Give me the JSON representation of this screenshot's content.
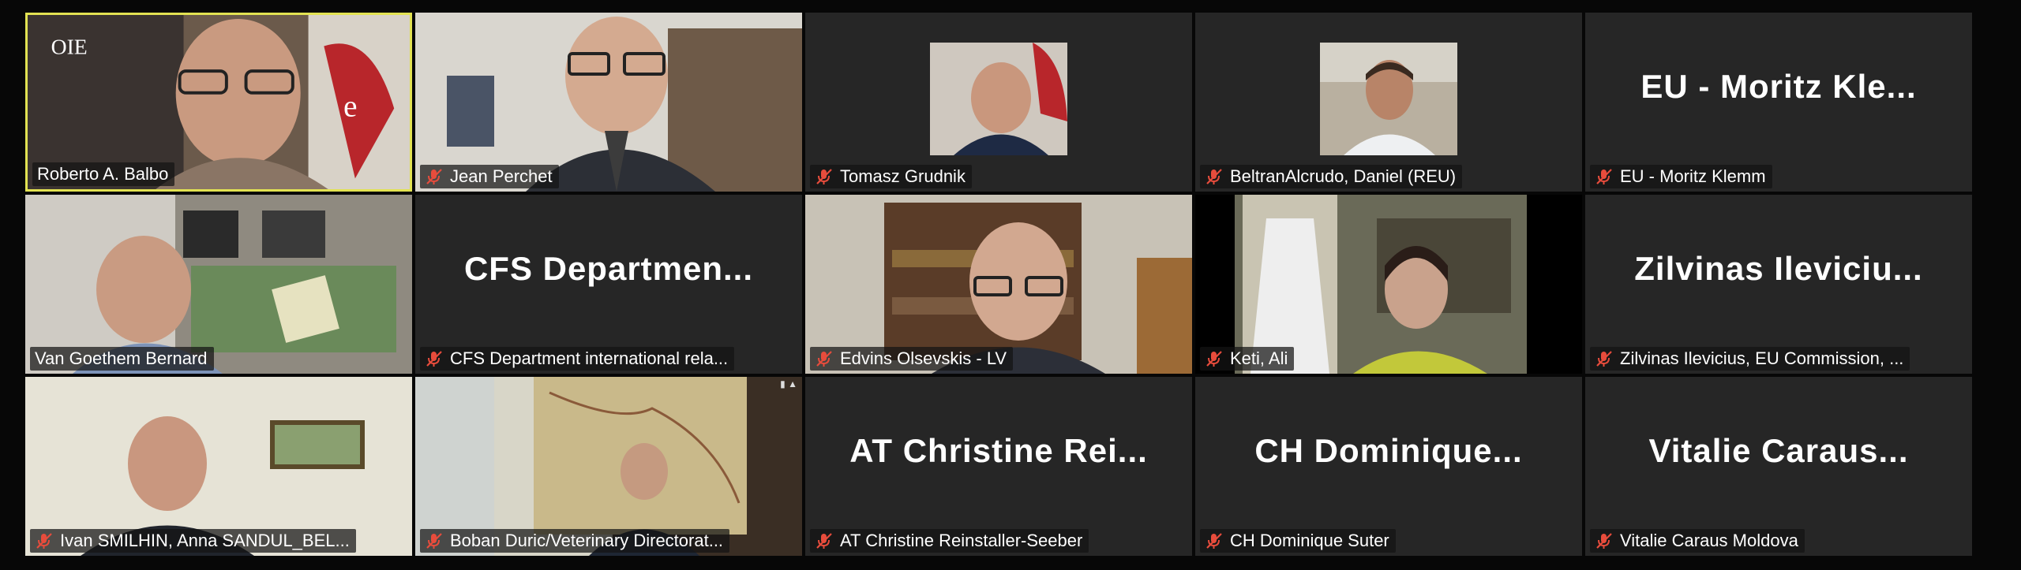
{
  "participants": [
    {
      "name": "Roberto A. Balbo",
      "display": "",
      "video": true,
      "muted": false,
      "active": true
    },
    {
      "name": "Jean Perchet",
      "display": "",
      "video": true,
      "muted": true,
      "active": false
    },
    {
      "name": "Tomasz Grudnik",
      "display": "",
      "video": false,
      "photo": true,
      "muted": true,
      "active": false
    },
    {
      "name": "BeltranAlcrudo, Daniel (REU)",
      "display": "",
      "video": false,
      "photo": true,
      "muted": true,
      "active": false
    },
    {
      "name": "EU - Moritz Klemm",
      "display": "EU - Moritz Kle...",
      "video": false,
      "muted": true,
      "active": false
    },
    {
      "name": "Van Goethem Bernard",
      "display": "",
      "video": true,
      "muted": false,
      "active": false
    },
    {
      "name": "CFS Department international rela...",
      "display": "CFS Departmen...",
      "video": false,
      "muted": true,
      "active": false
    },
    {
      "name": "Edvins Olsevskis - LV",
      "display": "",
      "video": true,
      "muted": true,
      "active": false
    },
    {
      "name": "Keti, Ali",
      "display": "",
      "video": true,
      "muted": true,
      "active": false
    },
    {
      "name": "Zilvinas Ilevicius, EU Commission, ...",
      "display": "Zilvinas Ileviciu...",
      "video": false,
      "muted": true,
      "active": false
    },
    {
      "name": "Ivan SMILHIN, Anna SANDUL_BEL...",
      "display": "",
      "video": true,
      "muted": true,
      "active": false
    },
    {
      "name": "Boban Duric/Veterinary Directorat...",
      "display": "",
      "video": true,
      "muted": true,
      "active": false
    },
    {
      "name": "AT Christine Reinstaller-Seeber",
      "display": "AT Christine Rei...",
      "video": false,
      "muted": true,
      "active": false
    },
    {
      "name": "CH Dominique Suter",
      "display": "CH Dominique...",
      "video": false,
      "muted": true,
      "active": false
    },
    {
      "name": "Vitalie Caraus Moldova",
      "display": "Vitalie Caraus...",
      "video": false,
      "muted": true,
      "active": false
    }
  ],
  "colors": {
    "active_border": "#e2e252",
    "tile_bg": "#262626",
    "mute_icon": "#e74c3c"
  },
  "icons": {
    "mute": "microphone-muted-icon"
  }
}
